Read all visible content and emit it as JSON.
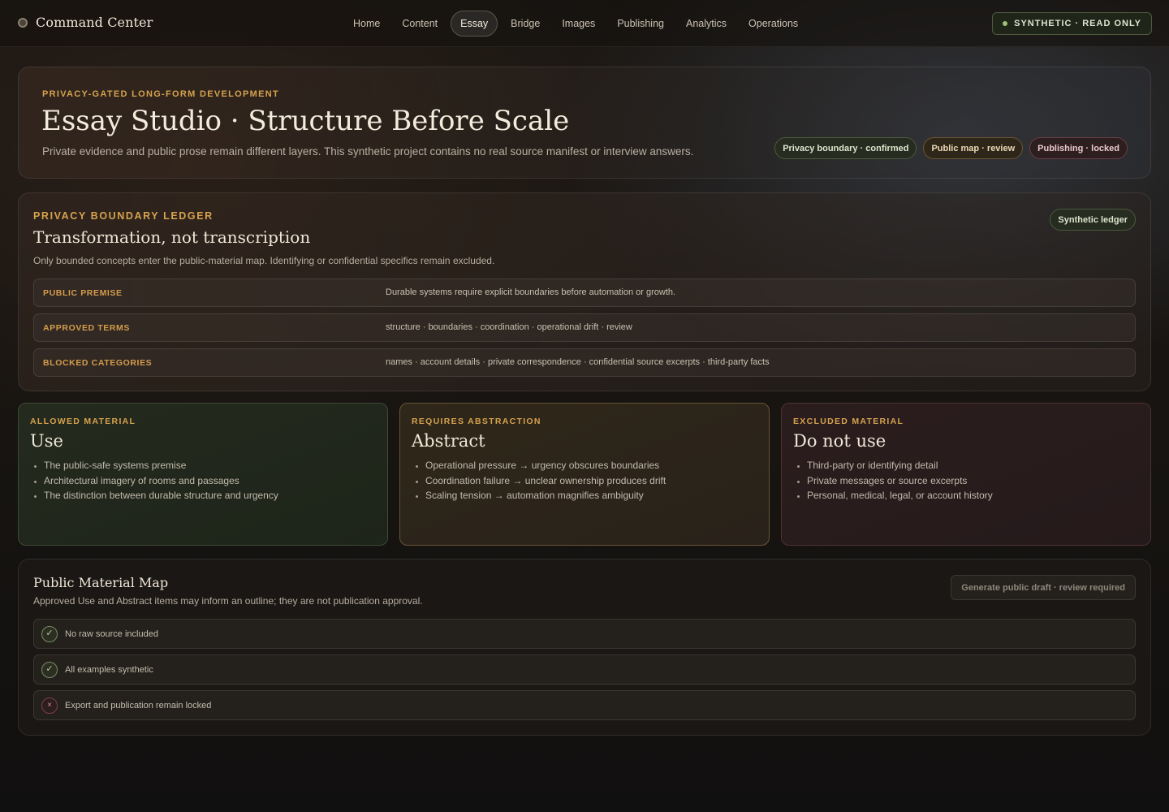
{
  "app": {
    "brand": "Command Center",
    "read_only_badge": "SYNTHETIC · READ ONLY"
  },
  "nav": {
    "items": [
      "Home",
      "Content",
      "Essay",
      "Bridge",
      "Images",
      "Publishing",
      "Analytics",
      "Operations"
    ],
    "active": "Essay"
  },
  "hero": {
    "eyebrow": "PRIVACY-GATED LONG-FORM DEVELOPMENT",
    "title": "Essay Studio · Structure Before Scale",
    "subtitle": "Private evidence and public prose remain different layers. This synthetic project contains no real source manifest or interview answers.",
    "pills": [
      {
        "label": "Privacy boundary · confirmed",
        "tone": "green"
      },
      {
        "label": "Public map · review",
        "tone": "amber"
      },
      {
        "label": "Publishing · locked",
        "tone": "red"
      }
    ]
  },
  "ledger": {
    "eyebrow": "PRIVACY BOUNDARY LEDGER",
    "title": "Transformation, not transcription",
    "subtitle": "Only bounded concepts enter the public-material map. Identifying or confidential specifics remain excluded.",
    "badge": "Synthetic ledger",
    "rows": [
      {
        "key": "PUBLIC PREMISE",
        "value": "Durable systems require explicit boundaries before automation or growth."
      },
      {
        "key": "APPROVED TERMS",
        "value": "structure · boundaries · coordination · operational drift · review"
      },
      {
        "key": "BLOCKED CATEGORIES",
        "value": "names · account details · private correspondence · confidential source excerpts · third-party facts"
      }
    ]
  },
  "cards": {
    "use": {
      "eyebrow": "ALLOWED MATERIAL",
      "title": "Use",
      "items": [
        "The public-safe systems premise",
        "Architectural imagery of rooms and passages",
        "The distinction between durable structure and urgency"
      ]
    },
    "abstract": {
      "eyebrow": "REQUIRES ABSTRACTION",
      "title": "Abstract",
      "items": [
        "Operational pressure → urgency obscures boundaries",
        "Coordination failure → unclear ownership produces drift",
        "Scaling tension → automation magnifies ambiguity"
      ]
    },
    "excluded": {
      "eyebrow": "EXCLUDED MATERIAL",
      "title": "Do not use",
      "items": [
        "Third-party or identifying detail",
        "Private messages or source excerpts",
        "Personal, medical, legal, or account history"
      ]
    }
  },
  "map": {
    "title": "Public Material Map",
    "subtitle": "Approved Use and Abstract items may inform an outline; they are not publication approval.",
    "generate_button": "Generate public draft · review required",
    "checks": [
      {
        "label": "No raw source included",
        "status": "ok",
        "icon": "check-icon"
      },
      {
        "label": "All examples synthetic",
        "status": "ok",
        "icon": "check-icon"
      },
      {
        "label": "Export and publication remain locked",
        "status": "blocked",
        "icon": "x-icon"
      }
    ]
  },
  "colors": {
    "accent_amber": "#d6a24e",
    "ok_green": "#9ec07a",
    "blocked_red": "#d88a93"
  }
}
